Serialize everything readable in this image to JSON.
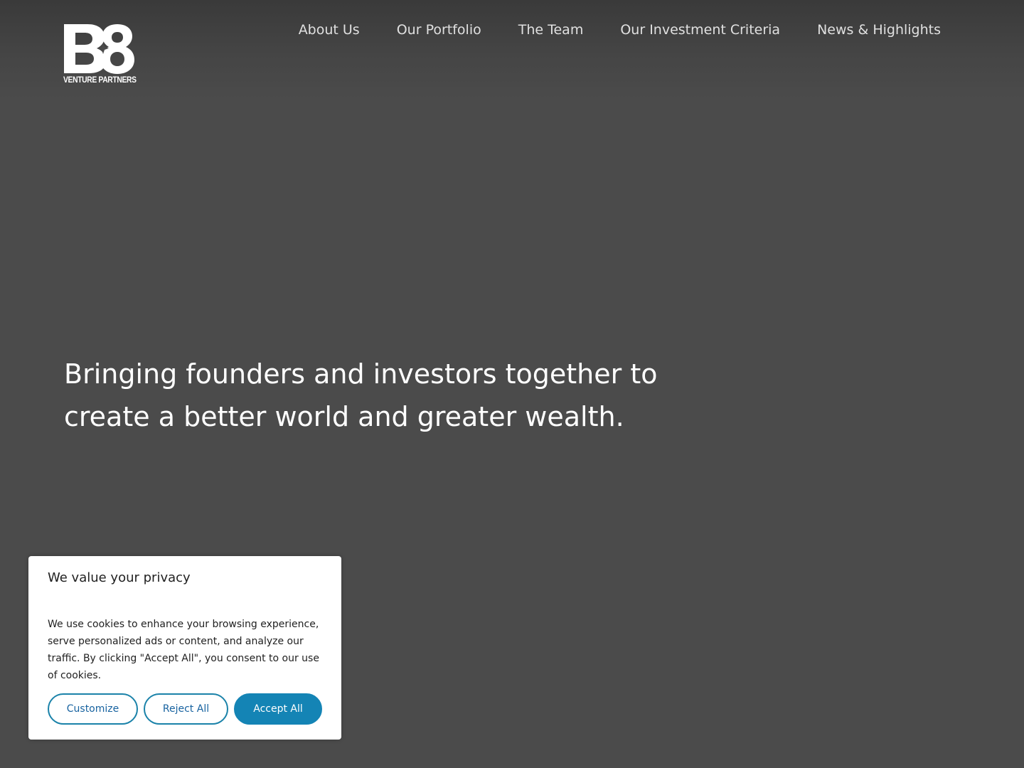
{
  "header": {
    "logo": {
      "mark": "B8",
      "subtitle": "VENTURE PARTNERS",
      "color": "#ffffff"
    },
    "nav": [
      {
        "label": "About Us"
      },
      {
        "label": "Our Portfolio"
      },
      {
        "label": "The Team"
      },
      {
        "label": "Our Investment Criteria"
      },
      {
        "label": "News & Highlights"
      }
    ]
  },
  "hero": {
    "tagline": "Bringing founders and investors together to create a better world and greater wealth."
  },
  "cookie_banner": {
    "title": "We value your privacy",
    "text": "We use cookies to enhance your browsing experience, serve personalized ads or content, and analyze our traffic. By clicking \"Accept All\", you consent to our use of cookies.",
    "buttons": {
      "customize": "Customize",
      "reject": "Reject All",
      "accept": "Accept All"
    },
    "accent_color": "#1484b5"
  },
  "colors": {
    "background": "#4b4b4b",
    "text": "#ffffff"
  }
}
